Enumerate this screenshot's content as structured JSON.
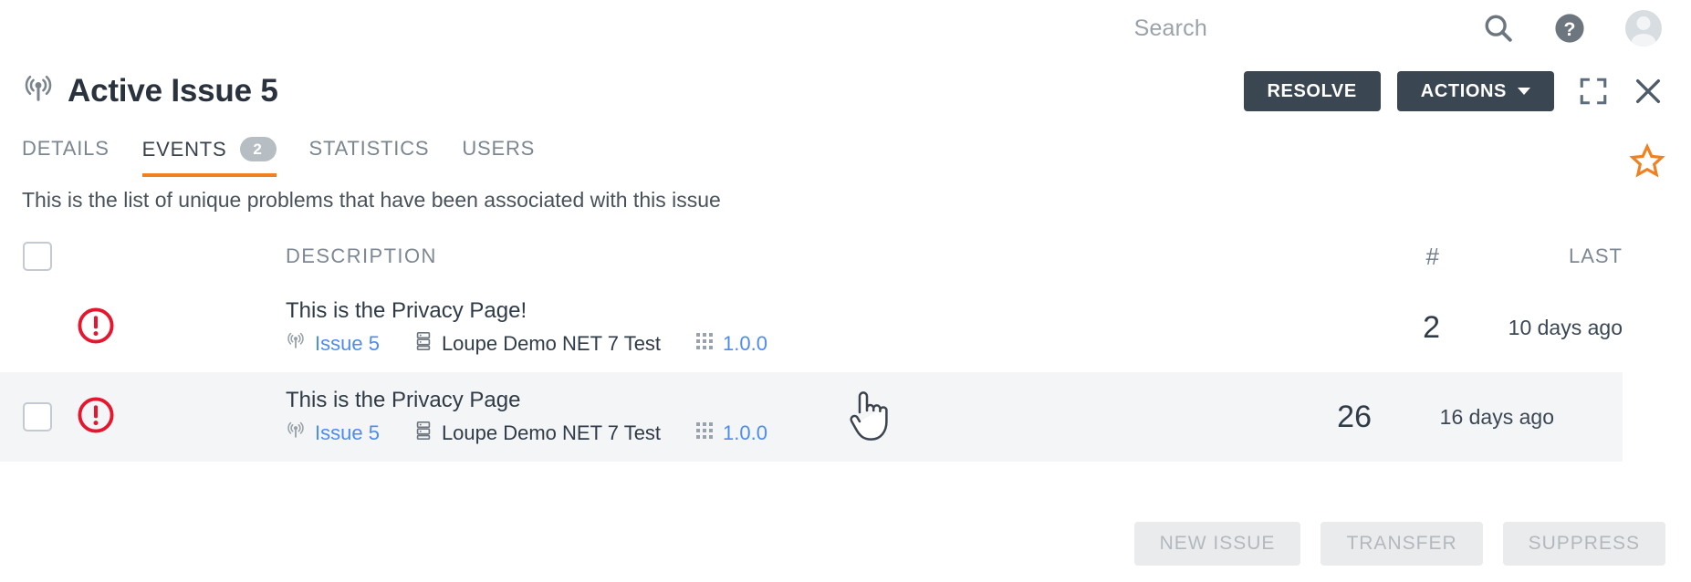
{
  "search": {
    "placeholder": "Search"
  },
  "topbar": {
    "search_icon": "search-icon",
    "help_icon": "help-icon",
    "avatar": "user-avatar"
  },
  "header": {
    "title": "Active Issue 5",
    "title_icon": "broadcast-icon",
    "resolve_label": "RESOLVE",
    "actions_label": "ACTIONS",
    "expand_icon": "expand-icon",
    "close_icon": "close-icon"
  },
  "tabs": [
    {
      "label": "DETAILS",
      "badge": "",
      "active": false
    },
    {
      "label": "EVENTS",
      "badge": "2",
      "active": true
    },
    {
      "label": "STATISTICS",
      "badge": "",
      "active": false
    },
    {
      "label": "USERS",
      "badge": "",
      "active": false
    }
  ],
  "favorite_icon": "star-icon",
  "subtitle": "This is the list of unique problems that have been associated with this issue",
  "table": {
    "columns": {
      "description": "DESCRIPTION",
      "count": "#",
      "last": "LAST"
    },
    "rows": [
      {
        "severity_icon": "error-icon",
        "description": "This is the Privacy Page!",
        "issue_link": "Issue 5",
        "issue_icon": "broadcast-icon",
        "application": "Loupe Demo NET 7 Test",
        "application_icon": "server-icon",
        "version": "1.0.0",
        "version_icon": "grid-icon",
        "count": "2",
        "last": "10 days ago",
        "highlighted": false,
        "checkbox_visible": false
      },
      {
        "severity_icon": "error-icon",
        "description": "This is the Privacy Page",
        "issue_link": "Issue 5",
        "issue_icon": "broadcast-icon",
        "application": "Loupe Demo NET 7 Test",
        "application_icon": "server-icon",
        "version": "1.0.0",
        "version_icon": "grid-icon",
        "count": "26",
        "last": "16 days ago",
        "highlighted": true,
        "checkbox_visible": true
      }
    ]
  },
  "footer": {
    "new_issue_label": "NEW ISSUE",
    "transfer_label": "TRANSFER",
    "suppress_label": "SUPPRESS"
  },
  "colors": {
    "accent": "#f08121",
    "dark_button": "#3a4651",
    "link": "#4c8cf0",
    "error": "#e5172f",
    "row_highlight": "#f4f5f7"
  }
}
